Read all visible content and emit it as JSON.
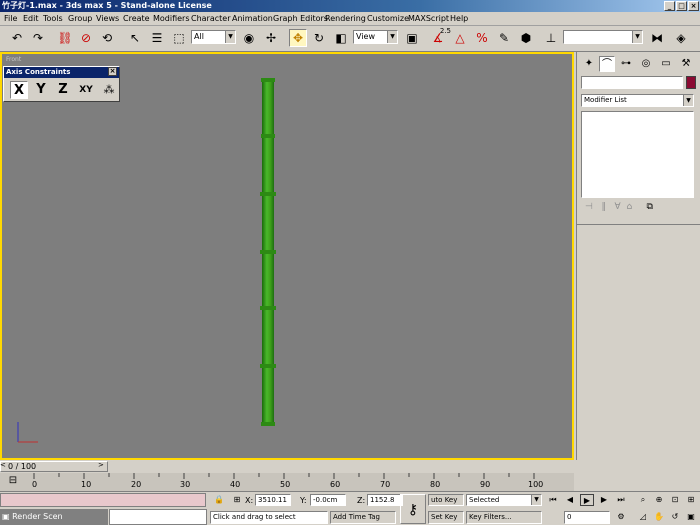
{
  "window": {
    "title": "竹子灯-1.max - 3ds max 5 - Stand-alone License"
  },
  "menu": [
    "File",
    "Edit",
    "Tools",
    "Group",
    "Views",
    "Create",
    "Modifiers",
    "Character",
    "Animation",
    "Graph Editors",
    "Rendering",
    "Customize",
    "MAXScript",
    "Help"
  ],
  "toolbar": {
    "selection_filter": "All",
    "coordinate_system": "View",
    "named_selection": "",
    "snap_angle_label": "2.5"
  },
  "viewport": {
    "label": "Front"
  },
  "axis_constraints": {
    "title": "Axis Constraints",
    "buttons": [
      "X",
      "Y",
      "Z",
      "XY"
    ]
  },
  "command_panel": {
    "name_field": "",
    "modifier_list": "Modifier List"
  },
  "timeline": {
    "frame_display": "0 / 100",
    "ticks": [
      "0",
      "10",
      "20",
      "30",
      "40",
      "50",
      "60",
      "70",
      "80",
      "90",
      "100"
    ]
  },
  "status": {
    "x_label": "X:",
    "x_value": "3510.11",
    "y_label": "Y:",
    "y_value": "-0.0cm",
    "z_label": "Z:",
    "z_value": "1152.8",
    "auto_key": "uto Key",
    "key_filter_value": "Selected",
    "set_key": "Set Key",
    "key_filters": "Key Filters...",
    "prompt": "Click and drag to select",
    "add_time_tag": "Add Time Tag",
    "current_frame": "0",
    "render_scene": "Render Scen"
  },
  "colors": {
    "viewport_bg": "#7e7e7e",
    "active_border": "#ffd800",
    "bamboo": "#3ea01a",
    "object_color": "#8b0a32"
  }
}
